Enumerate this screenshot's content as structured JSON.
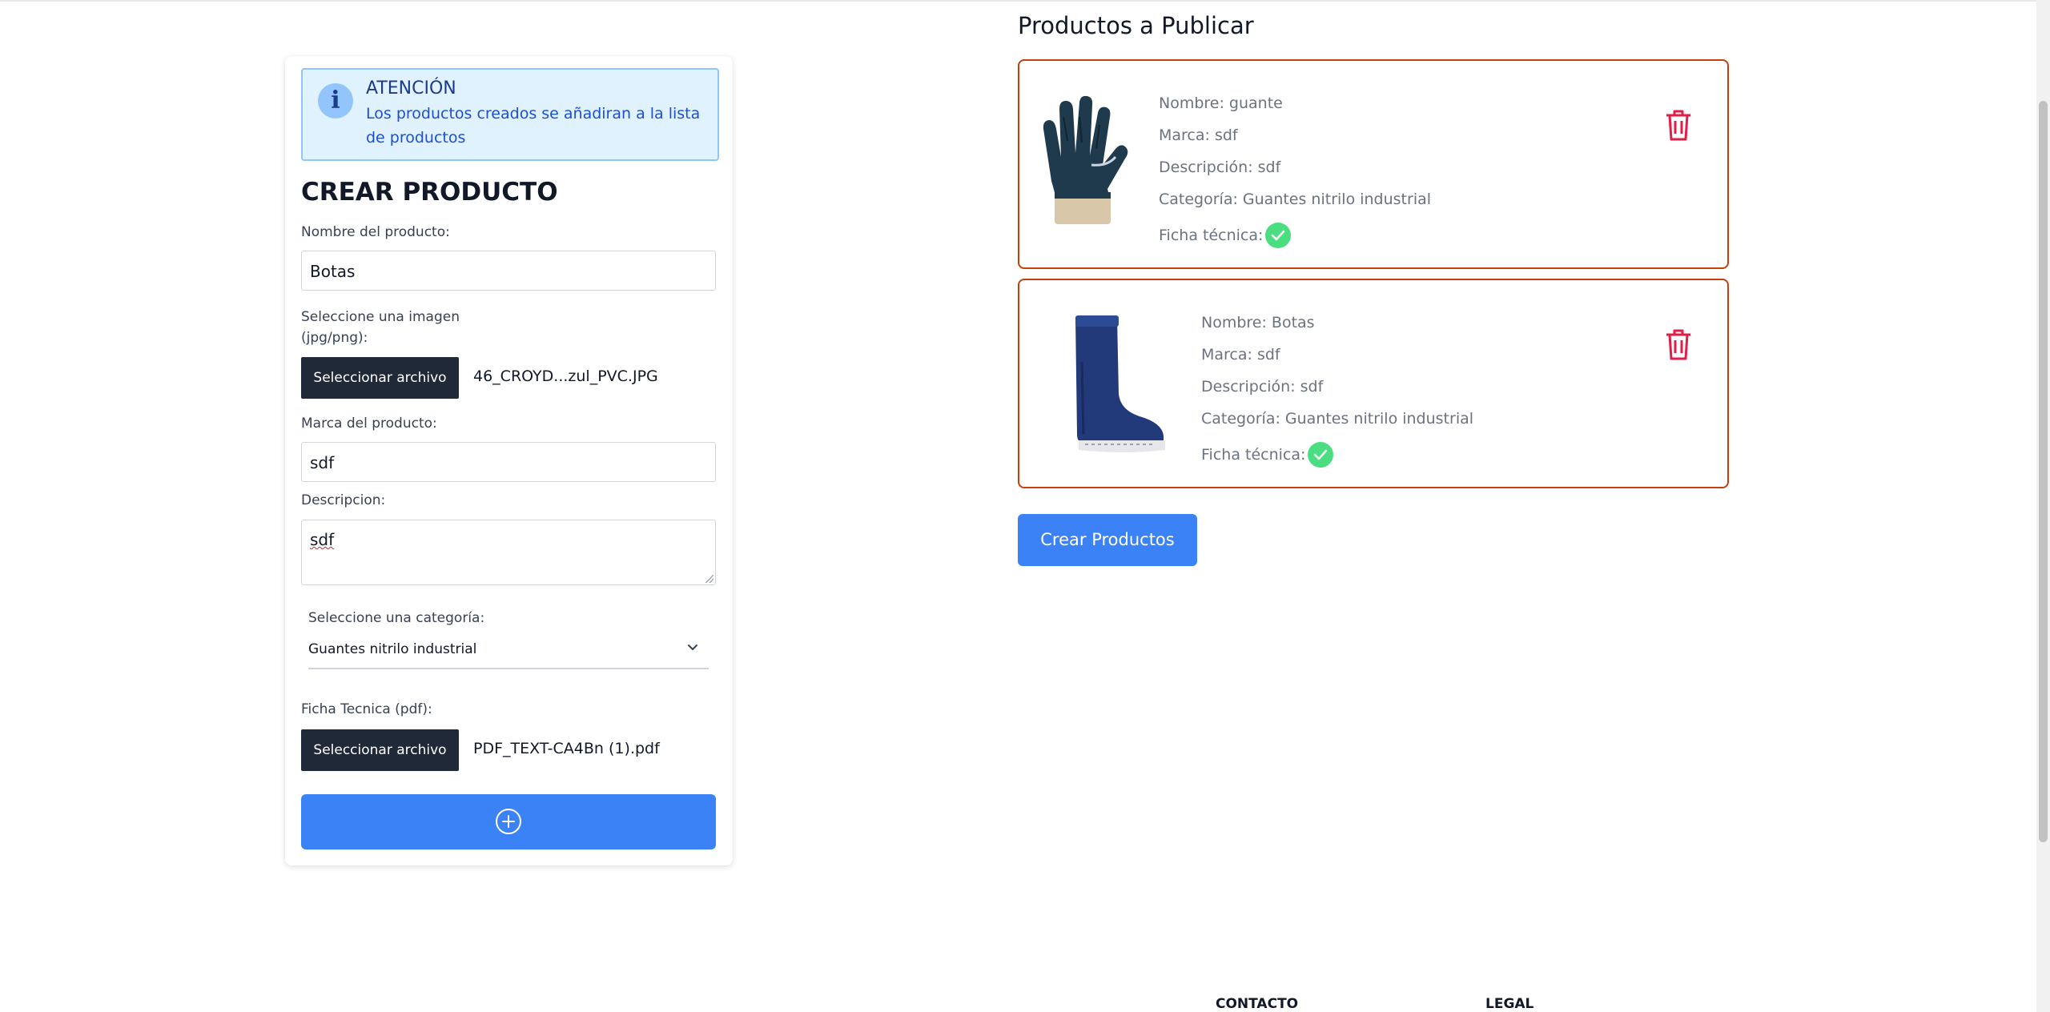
{
  "alert": {
    "title": "ATENCIÓN",
    "message": "Los productos creados se añadiran a la lista de productos"
  },
  "form": {
    "title": "CREAR PRODUCTO",
    "name_label": "Nombre del producto:",
    "name_value": "Botas",
    "image_label_line1": "Seleccione una imagen",
    "image_label_line2": "(jpg/png):",
    "image_button": "Seleccionar archivo",
    "image_file": "46_CROYD...zul_PVC.JPG",
    "brand_label": "Marca del producto:",
    "brand_value": "sdf",
    "description_label": "Descripcion:",
    "description_value": "sdf",
    "category_label": "Seleccione una categoría:",
    "category_value": "Guantes nitrilo industrial",
    "datasheet_label": "Ficha Tecnica (pdf):",
    "datasheet_button": "Seleccionar archivo",
    "datasheet_file": "PDF_TEXT-CA4Bn (1).pdf"
  },
  "products_title": "Productos a Publicar",
  "products": [
    {
      "name": "Nombre: guante",
      "brand": "Marca: sdf",
      "description": "Descripción: sdf",
      "category": "Categoría: Guantes nitrilo industrial",
      "datasheet": "Ficha técnica:",
      "image_icon": "glove-image"
    },
    {
      "name": "Nombre: Botas",
      "brand": "Marca: sdf",
      "description": "Descripción: sdf",
      "category": "Categoría: Guantes nitrilo industrial",
      "datasheet": "Ficha técnica:",
      "image_icon": "boot-image"
    }
  ],
  "create_products_button": "Crear Productos",
  "footer": {
    "contact": "CONTACTO",
    "legal": "LEGAL"
  },
  "colors": {
    "primary": "#3b82f6",
    "dark_button": "#1f2937",
    "card_border": "#c2410c",
    "trash": "#e11d48",
    "check": "#4ade80"
  }
}
